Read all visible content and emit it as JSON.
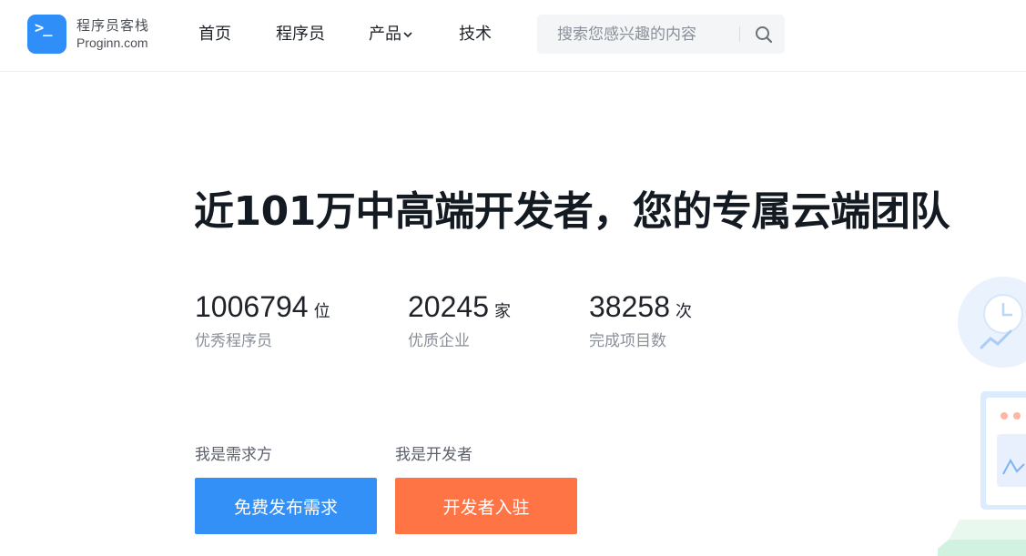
{
  "brand": {
    "name_cn": "程序员客栈",
    "name_en": "Proginn.com",
    "color": "#2f8ef8"
  },
  "nav": {
    "items": [
      {
        "label": "首页"
      },
      {
        "label": "程序员"
      },
      {
        "label": "产品",
        "has_dropdown": true
      },
      {
        "label": "技术"
      }
    ]
  },
  "search": {
    "placeholder": "搜索您感兴趣的内容",
    "value": "",
    "icon": "search-icon"
  },
  "hero": {
    "title": "近101万中高端开发者，您的专属云端团队"
  },
  "stats": [
    {
      "value": "1006794",
      "unit": "位",
      "label": "优秀程序员"
    },
    {
      "value": "20245",
      "unit": "家",
      "label": "优质企业"
    },
    {
      "value": "38258",
      "unit": "次",
      "label": "完成项目数"
    }
  ],
  "actions": {
    "client": {
      "role_label": "我是需求方",
      "button_label": "免费发布需求",
      "color": "#3290f6"
    },
    "developer": {
      "role_label": "我是开发者",
      "button_label": "开发者入驻",
      "color": "#ff7444"
    }
  }
}
